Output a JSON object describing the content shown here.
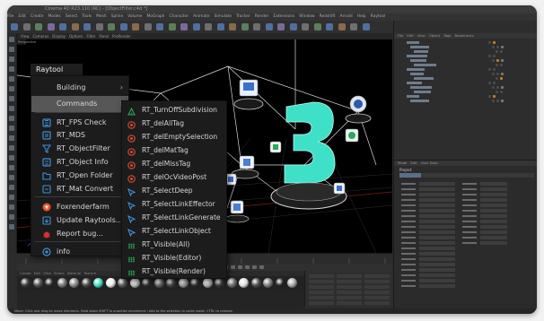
{
  "window": {
    "title": "Cinema 4D R23.110 (RC) - [ObjectFilter.c4d *]"
  },
  "menubar": [
    "File",
    "Edit",
    "Create",
    "Modes",
    "Select",
    "Tools",
    "Mesh",
    "Spline",
    "Volume",
    "MoGraph",
    "Character",
    "Animate",
    "Simulate",
    "Tracker",
    "Render",
    "Extensions",
    "Window",
    "Redshift",
    "Arnold",
    "Help",
    "Raytool"
  ],
  "viewport": {
    "header": [
      "View",
      "Cameras",
      "Display",
      "Options",
      "Filter",
      "Panel",
      "ProRender"
    ],
    "label": "Perspective"
  },
  "object_manager": {
    "menu": [
      "File",
      "Edit",
      "View",
      "Object",
      "Tags",
      "Bookmarks"
    ]
  },
  "attribute_manager": {
    "menu": [
      "Mode",
      "Edit",
      "User Data"
    ],
    "title": "Project"
  },
  "material_bar": {
    "menu": [
      "Create",
      "Edit",
      "View",
      "Select",
      "Material",
      "Texture"
    ]
  },
  "statusbar": {
    "text": "Move: Click and drag to move elements. Hold down SHIFT to quantize movement / add to the selection in point mode, CTRL to remove."
  },
  "raytool": {
    "title": "Raytool",
    "main_menu": [
      {
        "label": "Building",
        "submenu": true,
        "icon": ""
      },
      {
        "label": "Commands",
        "submenu": true,
        "icon": "",
        "selected": true
      },
      {
        "label": "RT_FPS Check",
        "icon": "fps-check-icon",
        "color": "#3d8fd6"
      },
      {
        "label": "RT_MDS",
        "icon": "mds-icon",
        "color": "#3d8fd6"
      },
      {
        "label": "RT_ObjectFilter",
        "icon": "filter-icon",
        "color": "#3d8fd6"
      },
      {
        "label": "RT_Object Info",
        "icon": "info-icon",
        "color": "#3d8fd6"
      },
      {
        "label": "RT_Open Folder",
        "icon": "folder-icon",
        "color": "#3d8fd6"
      },
      {
        "label": "RT_Mat Convert",
        "icon": "convert-icon",
        "color": "#3d8fd6"
      },
      {
        "label": "Foxrenderfarm",
        "icon": "foxrenderfarm-icon",
        "color": "#e8562a"
      },
      {
        "label": "Update Raytools...",
        "icon": "update-icon",
        "color": "#3d8fd6"
      },
      {
        "label": "Report bug...",
        "icon": "bug-icon",
        "color": "#d93030"
      },
      {
        "label": "info",
        "icon": "info-circle-icon",
        "color": "#3d8fd6"
      }
    ],
    "commands_menu": [
      {
        "label": "RT_TurnOffSubdivision",
        "icon": "subdivision-icon",
        "color": "#2aa85a"
      },
      {
        "label": "RT_delAllTag",
        "icon": "delete-tag-icon",
        "color": "#d94a2e"
      },
      {
        "label": "RT_delEmptySelection",
        "icon": "delete-selection-icon",
        "color": "#d94a2e"
      },
      {
        "label": "RT_delMatTag",
        "icon": "delete-mat-icon",
        "color": "#d94a2e"
      },
      {
        "label": "RT_delMissTag",
        "icon": "delete-miss-icon",
        "color": "#d94a2e"
      },
      {
        "label": "RT_delOcVideoPost",
        "icon": "delete-videopost-icon",
        "color": "#d94a2e"
      },
      {
        "label": "RT_SelectDeep",
        "icon": "select-deep-icon",
        "color": "#3d8fd6"
      },
      {
        "label": "RT_SelectLinkEffector",
        "icon": "select-link-icon",
        "color": "#3d8fd6"
      },
      {
        "label": "RT_SelectLinkGenerate",
        "icon": "select-link-icon",
        "color": "#3d8fd6"
      },
      {
        "label": "RT_SelectLinkObject",
        "icon": "select-link-icon",
        "color": "#3d8fd6"
      },
      {
        "label": "RT_Visible(All)",
        "icon": "visible-dots-icon",
        "color": "#2aa85a"
      },
      {
        "label": "RT_Visible(Editor)",
        "icon": "visible-dots-icon",
        "color": "#2aa85a"
      },
      {
        "label": "RT_Visible(Render)",
        "icon": "visible-dots-icon",
        "color": "#2aa85a"
      }
    ]
  },
  "colors": {
    "accent_teal": "#3fe0c8",
    "menu_bg": "#1c1c1c",
    "selected_bg": "#575757"
  }
}
